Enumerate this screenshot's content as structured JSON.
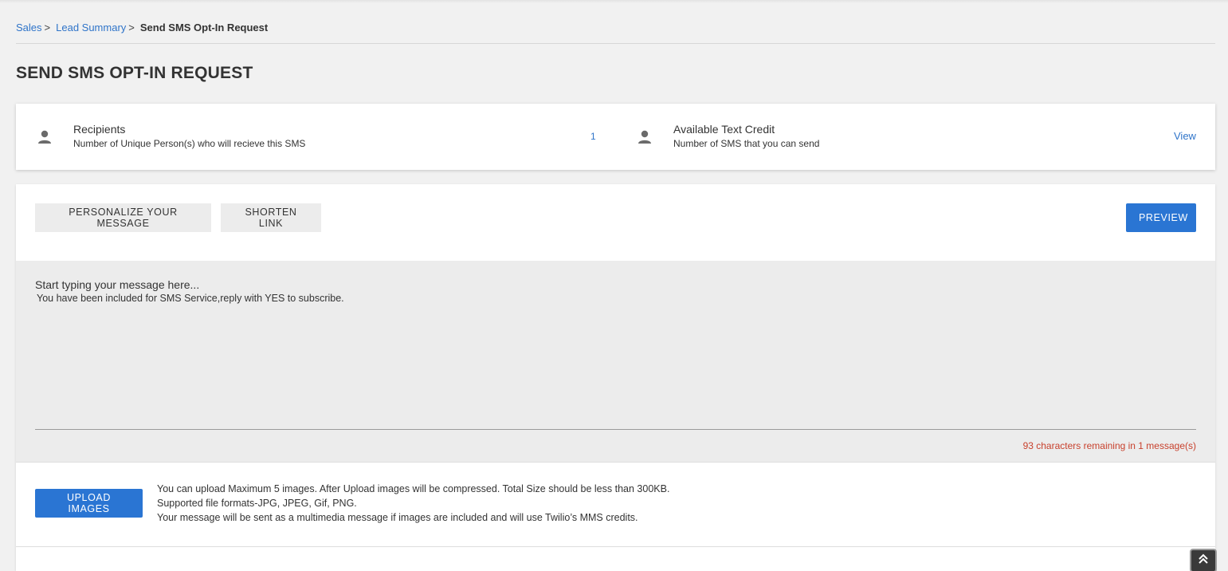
{
  "breadcrumb": {
    "items": [
      "Sales",
      "Lead Summary"
    ],
    "separator": ">",
    "current": "Send SMS Opt-In Request"
  },
  "page": {
    "title": "SEND SMS OPT-IN REQUEST"
  },
  "stats": {
    "recipients": {
      "icon": "person-icon",
      "title": "Recipients",
      "subtitle": "Number of Unique Person(s) who will recieve this SMS",
      "value": "1"
    },
    "credit": {
      "icon": "person-icon",
      "title": "Available Text Credit",
      "subtitle": "Number of SMS that you can send",
      "link": "View"
    }
  },
  "toolbar": {
    "personalize_label": "PERSONALIZE YOUR MESSAGE",
    "shorten_label": "SHORTEN LINK",
    "preview_label": "PREVIEW"
  },
  "message": {
    "placeholder": "Start typing your message here...",
    "text": "You have been included for SMS Service,reply with YES to subscribe.",
    "remaining": "93 characters remaining in 1 message(s)"
  },
  "upload": {
    "button_label": "UPLOAD IMAGES",
    "info_lines": [
      "You can upload Maximum 5 images. After Upload images will be compressed. Total Size should be less than 300KB.",
      "Supported file formats-JPG, JPEG, Gif, PNG.",
      "Your message will be sent as a multimedia message if images are included and will use Twilio’s MMS credits."
    ]
  },
  "scroll_top": {
    "icon": "double-chevron-up-icon"
  },
  "colors": {
    "accent": "#2a75d3",
    "link": "#2f74c9",
    "warning": "#c8412d",
    "background": "#f1f1f1"
  }
}
